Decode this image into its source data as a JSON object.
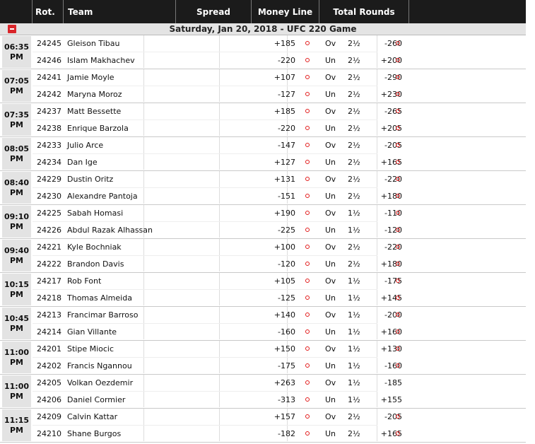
{
  "header": {
    "rot": "Rot.",
    "team": "Team",
    "spread": "Spread",
    "money_line": "Money Line",
    "total_rounds": "Total Rounds"
  },
  "event_title": "Saturday, Jan 20, 2018 - UFC 220 Game",
  "games": [
    {
      "time": "06:35",
      "ampm": "PM",
      "rows": [
        {
          "rot": "24245",
          "team": "Gleison Tibau",
          "ml": "+185",
          "ml_link": true,
          "ou": "Ov",
          "pts": "2½",
          "odds": "-260",
          "odds_link": true
        },
        {
          "rot": "24246",
          "team": "Islam Makhachev",
          "ml": "-220",
          "ml_link": true,
          "ou": "Un",
          "pts": "2½",
          "odds": "+200",
          "odds_link": true
        }
      ]
    },
    {
      "time": "07:05",
      "ampm": "PM",
      "rows": [
        {
          "rot": "24241",
          "team": "Jamie Moyle",
          "ml": "+107",
          "ml_link": true,
          "ou": "Ov",
          "pts": "2½",
          "odds": "-290",
          "odds_link": true
        },
        {
          "rot": "24242",
          "team": "Maryna Moroz",
          "ml": "-127",
          "ml_link": true,
          "ou": "Un",
          "pts": "2½",
          "odds": "+230",
          "odds_link": true
        }
      ]
    },
    {
      "time": "07:35",
      "ampm": "PM",
      "rows": [
        {
          "rot": "24237",
          "team": "Matt Bessette",
          "ml": "+185",
          "ml_link": true,
          "ou": "Ov",
          "pts": "2½",
          "odds": "-265",
          "odds_link": true
        },
        {
          "rot": "24238",
          "team": "Enrique Barzola",
          "ml": "-220",
          "ml_link": true,
          "ou": "Un",
          "pts": "2½",
          "odds": "+205",
          "odds_link": true
        }
      ]
    },
    {
      "time": "08:05",
      "ampm": "PM",
      "rows": [
        {
          "rot": "24233",
          "team": "Julio Arce",
          "ml": "-147",
          "ml_link": true,
          "ou": "Ov",
          "pts": "2½",
          "odds": "-205",
          "odds_link": true
        },
        {
          "rot": "24234",
          "team": "Dan Ige",
          "ml": "+127",
          "ml_link": true,
          "ou": "Un",
          "pts": "2½",
          "odds": "+165",
          "odds_link": true
        }
      ]
    },
    {
      "time": "08:40",
      "ampm": "PM",
      "rows": [
        {
          "rot": "24229",
          "team": "Dustin Oritz",
          "ml": "+131",
          "ml_link": true,
          "ou": "Ov",
          "pts": "2½",
          "odds": "-220",
          "odds_link": true
        },
        {
          "rot": "24230",
          "team": "Alexandre Pantoja",
          "ml": "-151",
          "ml_link": true,
          "ou": "Un",
          "pts": "2½",
          "odds": "+180",
          "odds_link": true
        }
      ]
    },
    {
      "time": "09:10",
      "ampm": "PM",
      "rows": [
        {
          "rot": "24225",
          "team": "Sabah Homasi",
          "ml": "+190",
          "ml_link": true,
          "ou": "Ov",
          "pts": "1½",
          "odds": "-110",
          "odds_link": true
        },
        {
          "rot": "24226",
          "team": "Abdul Razak Alhassan",
          "ml": "-225",
          "ml_link": true,
          "ou": "Un",
          "pts": "1½",
          "odds": "-120",
          "odds_link": true
        }
      ]
    },
    {
      "time": "09:40",
      "ampm": "PM",
      "rows": [
        {
          "rot": "24221",
          "team": "Kyle Bochniak",
          "ml": "+100",
          "ml_link": true,
          "ou": "Ov",
          "pts": "2½",
          "odds": "-220",
          "odds_link": true
        },
        {
          "rot": "24222",
          "team": "Brandon Davis",
          "ml": "-120",
          "ml_link": true,
          "ou": "Un",
          "pts": "2½",
          "odds": "+180",
          "odds_link": true
        }
      ]
    },
    {
      "time": "10:15",
      "ampm": "PM",
      "rows": [
        {
          "rot": "24217",
          "team": "Rob Font",
          "ml": "+105",
          "ml_link": true,
          "ou": "Ov",
          "pts": "1½",
          "odds": "-175",
          "odds_link": true
        },
        {
          "rot": "24218",
          "team": "Thomas Almeida",
          "ml": "-125",
          "ml_link": true,
          "ou": "Un",
          "pts": "1½",
          "odds": "+145",
          "odds_link": true
        }
      ]
    },
    {
      "time": "10:45",
      "ampm": "PM",
      "rows": [
        {
          "rot": "24213",
          "team": "Francimar Barroso",
          "ml": "+140",
          "ml_link": true,
          "ou": "Ov",
          "pts": "1½",
          "odds": "-200",
          "odds_link": true
        },
        {
          "rot": "24214",
          "team": "Gian Villante",
          "ml": "-160",
          "ml_link": true,
          "ou": "Un",
          "pts": "1½",
          "odds": "+160",
          "odds_link": true
        }
      ]
    },
    {
      "time": "11:00",
      "ampm": "PM",
      "rows": [
        {
          "rot": "24201",
          "team": "Stipe Miocic",
          "ml": "+150",
          "ml_link": true,
          "ou": "Ov",
          "pts": "1½",
          "odds": "+130",
          "odds_link": true
        },
        {
          "rot": "24202",
          "team": "Francis Ngannou",
          "ml": "-175",
          "ml_link": true,
          "ou": "Un",
          "pts": "1½",
          "odds": "-160",
          "odds_link": true
        }
      ]
    },
    {
      "time": "11:00",
      "ampm": "PM",
      "rows": [
        {
          "rot": "24205",
          "team": "Volkan Oezdemir",
          "ml": "+263",
          "ml_link": true,
          "ou": "Ov",
          "pts": "1½",
          "odds": "-185",
          "odds_link": false
        },
        {
          "rot": "24206",
          "team": "Daniel Cormier",
          "ml": "-313",
          "ml_link": true,
          "ou": "Un",
          "pts": "1½",
          "odds": "+155",
          "odds_link": false
        }
      ]
    },
    {
      "time": "11:15",
      "ampm": "PM",
      "rows": [
        {
          "rot": "24209",
          "team": "Calvin Kattar",
          "ml": "+157",
          "ml_link": true,
          "ou": "Ov",
          "pts": "2½",
          "odds": "-205",
          "odds_link": true
        },
        {
          "rot": "24210",
          "team": "Shane Burgos",
          "ml": "-182",
          "ml_link": true,
          "ou": "Un",
          "pts": "2½",
          "odds": "+165",
          "odds_link": true
        }
      ]
    }
  ]
}
